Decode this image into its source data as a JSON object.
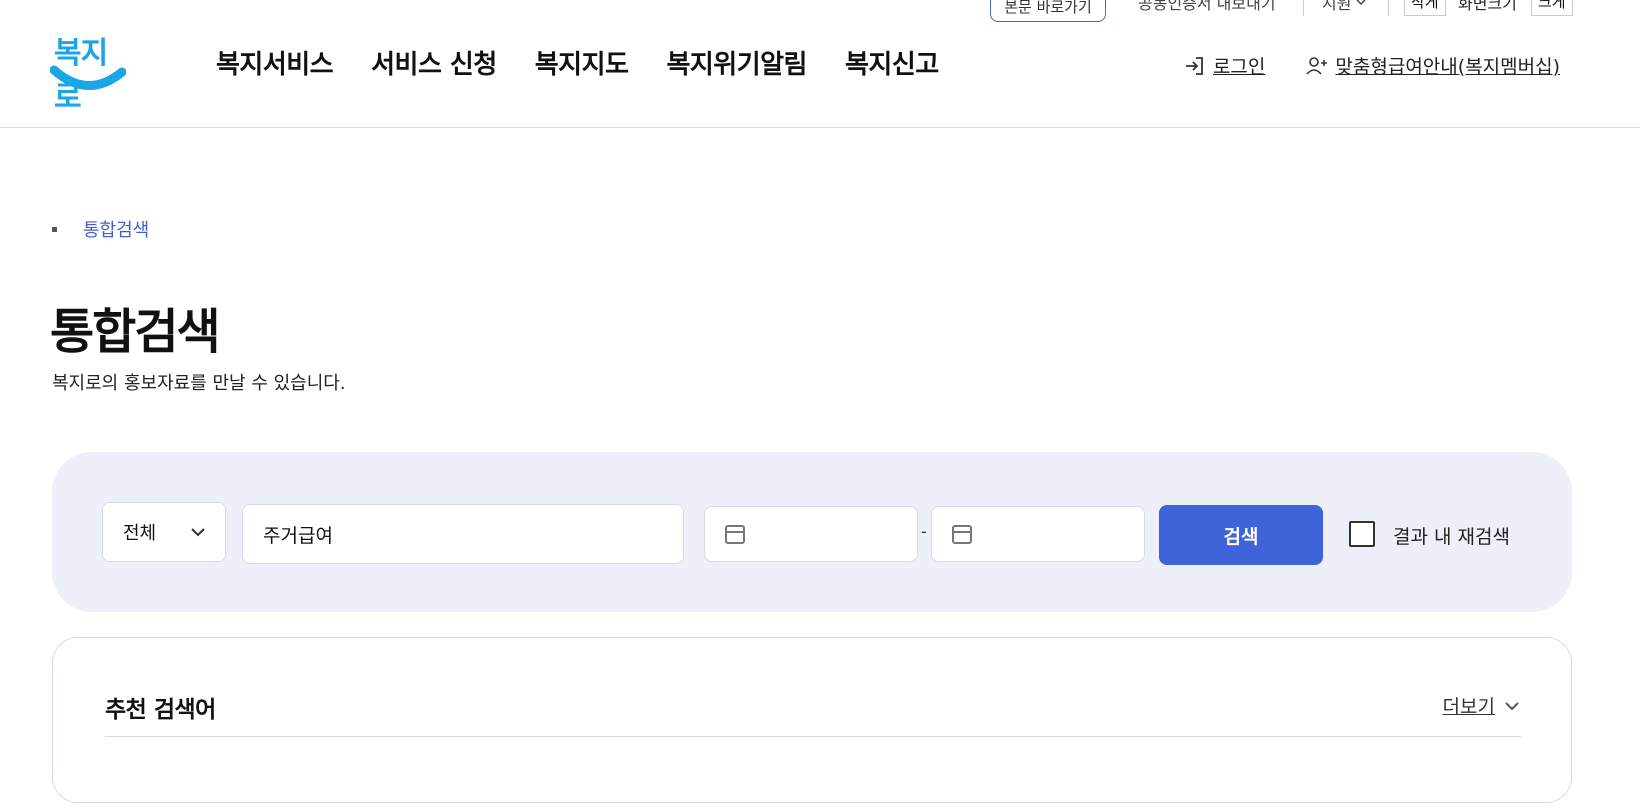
{
  "utility": {
    "skip_label": "본문 바로가기",
    "cert_label": "공동인증서 내보내기",
    "region_label": "지원",
    "small_label": "작게",
    "zoom_label": "화면크기",
    "large_label": "크게"
  },
  "header": {
    "logo_text": "복지로",
    "nav": [
      "복지서비스",
      "서비스 신청",
      "복지지도",
      "복지위기알림",
      "복지신고"
    ],
    "login_label": "로그인",
    "membership_label": "맞춤형급여안내(복지멤버십)"
  },
  "breadcrumb": {
    "current": "통합검색"
  },
  "page": {
    "title": "통합검색",
    "description": "복지로의 홍보자료를 만날 수 있습니다."
  },
  "search": {
    "category_selected": "전체",
    "keyword_value": "주거급여",
    "date_separator": "-",
    "submit_label": "검색",
    "refine_label": "결과 내 재검색",
    "refine_checked": false
  },
  "recommended": {
    "title": "추천 검색어",
    "more_label": "더보기"
  },
  "colors": {
    "accent": "#3f63d8",
    "panel_bg": "#edf0f9",
    "logo_blue": "#1aa6e6"
  }
}
